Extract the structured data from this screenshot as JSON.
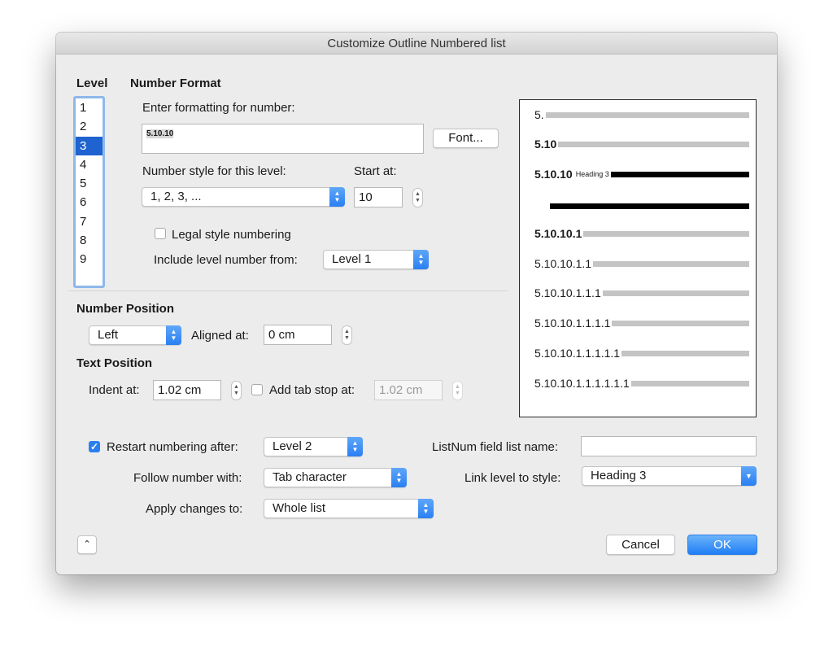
{
  "window": {
    "title": "Customize Outline Numbered list"
  },
  "level": {
    "heading": "Level",
    "items": [
      "1",
      "2",
      "3",
      "4",
      "5",
      "6",
      "7",
      "8",
      "9"
    ],
    "selected": "3"
  },
  "number_format": {
    "heading": "Number Format",
    "enter_label": "Enter formatting for number:",
    "format_value": "5.10.10",
    "font_button": "Font...",
    "style_label": "Number style for this level:",
    "style_value": "1, 2, 3, ...",
    "start_label": "Start at:",
    "start_value": "10",
    "legal_label": "Legal style numbering",
    "legal_checked": false,
    "include_label": "Include level number from:",
    "include_value": "Level 1"
  },
  "number_position": {
    "heading": "Number Position",
    "alignment_value": "Left",
    "aligned_label": "Aligned at:",
    "aligned_value": "0 cm"
  },
  "text_position": {
    "heading": "Text Position",
    "indent_label": "Indent at:",
    "indent_value": "1.02 cm",
    "tab_label": "Add tab stop at:",
    "tab_value": "1.02 cm",
    "tab_checked": false
  },
  "bottom": {
    "restart_label": "Restart numbering after:",
    "restart_checked": true,
    "restart_value": "Level 2",
    "follow_label": "Follow number with:",
    "follow_value": "Tab character",
    "apply_label": "Apply changes to:",
    "apply_value": "Whole list",
    "listnum_label": "ListNum field list name:",
    "listnum_value": "",
    "link_label": "Link level to style:",
    "link_value": "Heading 3"
  },
  "preview": {
    "rows": [
      {
        "num": "5."
      },
      {
        "num": "5.10"
      },
      {
        "num": "5.10.10",
        "note": "Heading 3"
      },
      {
        "num": "5.10.10.1"
      },
      {
        "num": "5.10.10.1.1"
      },
      {
        "num": "5.10.10.1.1.1"
      },
      {
        "num": "5.10.10.1.1.1.1"
      },
      {
        "num": "5.10.10.1.1.1.1.1"
      },
      {
        "num": "5.10.10.1.1.1.1.1.1"
      }
    ]
  },
  "buttons": {
    "cancel": "Cancel",
    "ok": "OK",
    "collapse_icon": "chevron-up-icon"
  },
  "colors": {
    "accent": "#2a7ff2",
    "selection": "#1e63cf"
  }
}
